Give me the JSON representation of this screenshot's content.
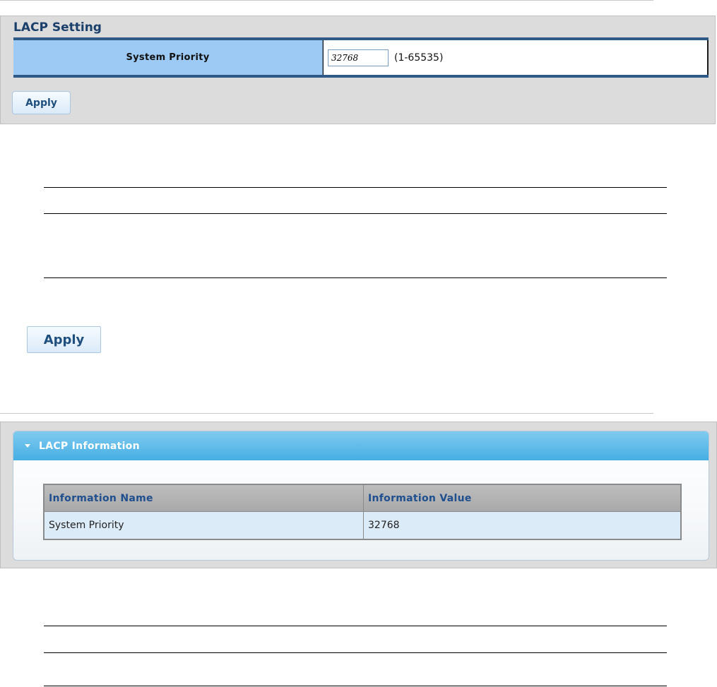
{
  "lacp_setting": {
    "title": "LACP Setting",
    "system_priority_label": "System Priority",
    "system_priority_value": "32768",
    "range_hint": "(1-65535)",
    "apply_label": "Apply"
  },
  "apply_large_label": "Apply",
  "lacp_information": {
    "title": "LACP Information",
    "columns": [
      "Information Name",
      "Information Value"
    ],
    "rows": [
      [
        "System Priority",
        "32768"
      ]
    ]
  },
  "colors": {
    "panel_bg": "#dcdcdc",
    "label_cell_bg": "#9ccaf5",
    "table_rule": "#2f5a88",
    "header_bar_top": "#7fcbef",
    "header_bar_bottom": "#46aee4",
    "row_bg": "#dcebf8",
    "column_header_text": "#1f4f8e"
  },
  "icons": {
    "collapse": "caret-down-icon"
  }
}
